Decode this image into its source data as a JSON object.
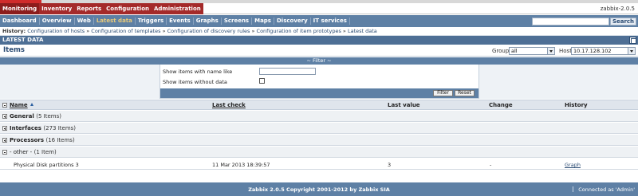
{
  "main_menu": {
    "tabs": [
      {
        "label": "Monitoring",
        "active": true
      },
      {
        "label": "Inventory",
        "active": false
      },
      {
        "label": "Reports",
        "active": false
      },
      {
        "label": "Configuration",
        "active": false
      },
      {
        "label": "Administration",
        "active": false
      }
    ],
    "version": "zabbix-2.0.5"
  },
  "sub_menu": {
    "items": [
      {
        "label": "Dashboard",
        "active": false
      },
      {
        "label": "Overview",
        "active": false
      },
      {
        "label": "Web",
        "active": false
      },
      {
        "label": "Latest data",
        "active": true
      },
      {
        "label": "Triggers",
        "active": false
      },
      {
        "label": "Events",
        "active": false
      },
      {
        "label": "Graphs",
        "active": false
      },
      {
        "label": "Screens",
        "active": false
      },
      {
        "label": "Maps",
        "active": false
      },
      {
        "label": "Discovery",
        "active": false
      },
      {
        "label": "IT services",
        "active": false
      }
    ],
    "search_button": "Search",
    "search_value": ""
  },
  "history": {
    "label": "History:",
    "links": [
      "Configuration of hosts",
      "Configuration of templates",
      "Configuration of discovery rules",
      "Configuration of item prototypes",
      "Latest data"
    ],
    "separator": "»"
  },
  "latest_bar": {
    "title": "LATEST DATA"
  },
  "items_header": {
    "title": "Items",
    "group_label": "Group",
    "group_value": "all",
    "host_label": "Host",
    "host_value": "10.17.128.102"
  },
  "filter": {
    "title": "~ Filter ~",
    "name_label": "Show items with name like",
    "name_value": "",
    "without_data_label": "Show items without data",
    "without_data_checked": false,
    "filter_button": "Filter",
    "reset_button": "Reset"
  },
  "table": {
    "headers": {
      "name": "Name",
      "last_check": "Last check",
      "last_value": "Last value",
      "change": "Change",
      "history": "History"
    },
    "groups": [
      {
        "name": "General",
        "count": "(5 Items)",
        "expanded": false
      },
      {
        "name": "Interfaces",
        "count": "(273 Items)",
        "expanded": false
      },
      {
        "name": "Processors",
        "count": "(16 Items)",
        "expanded": false
      },
      {
        "name": "- other -",
        "count": "(1 Item)",
        "expanded": true
      }
    ],
    "rows": [
      {
        "name": "Physical Disk partitions 3",
        "last_check": "11 Mar 2013 18:39:57",
        "last_value": "3",
        "change": "-",
        "history": "Graph"
      }
    ]
  },
  "footer": {
    "copyright": "Zabbix 2.0.5 Copyright 2001-2012 by Zabbix SIA",
    "connected": "Connected as 'Admin'"
  },
  "colors": {
    "brand_red": "#a42a2a",
    "menu_blue": "#5e80a5",
    "header_blue": "#4e6f95",
    "active_yellow": "#e8c97a"
  }
}
